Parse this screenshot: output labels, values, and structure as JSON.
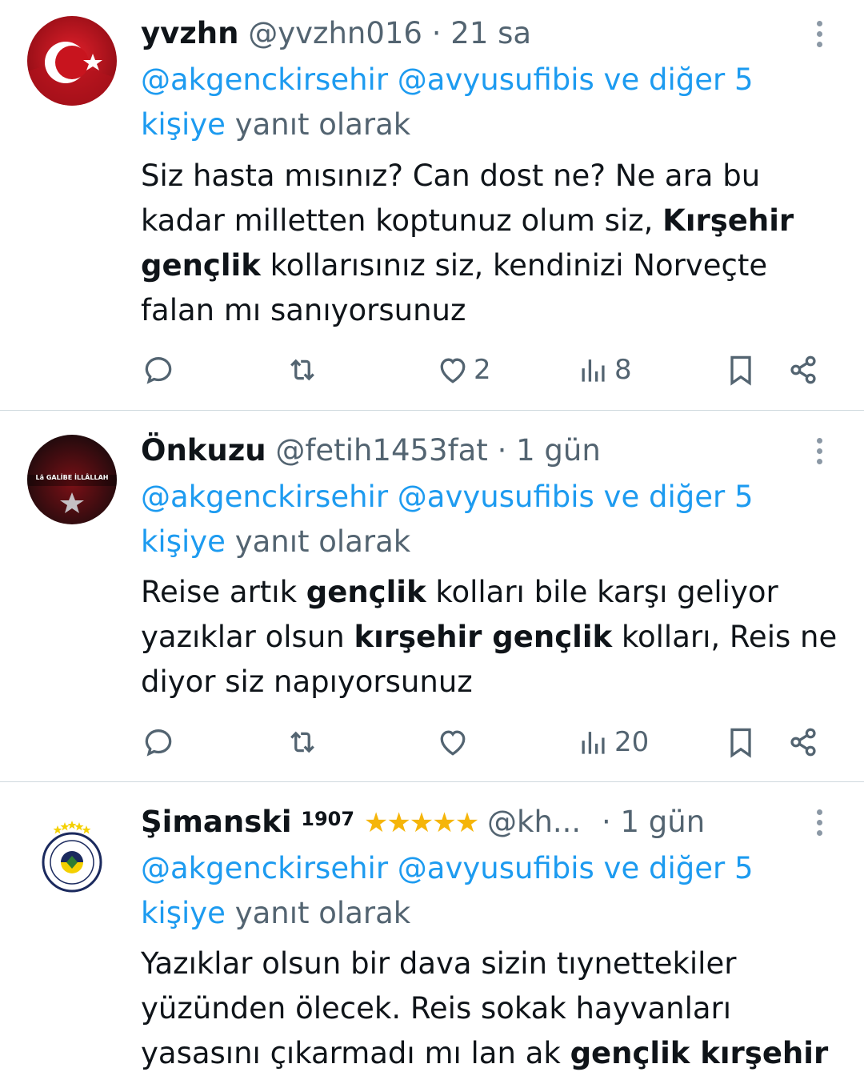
{
  "tweets": [
    {
      "display_name": "yvzhn",
      "handle": "@yvzhn016",
      "time": "21 sa",
      "reply_mentions": "@akgenckirsehir @avyusufibis ve diğer 5 kişiye",
      "reply_suffix": "yanıt olarak",
      "body_parts": [
        {
          "text": "Siz hasta mısınız? Can dost ne? Ne ara bu kadar milletten koptunuz olum siz, ",
          "bold": false
        },
        {
          "text": "Kırşehir gençlik",
          "bold": true
        },
        {
          "text": " kollarısınız siz, kendinizi Norveçte falan mı sanıyorsunuz",
          "bold": false
        }
      ],
      "likes": "2",
      "views": "8",
      "avatar": "turkish-flag"
    },
    {
      "display_name": "Önkuzu",
      "handle": "@fetih1453fat",
      "time": "1 gün",
      "reply_mentions": "@akgenckirsehir @avyusufibis ve diğer 5 kişiye",
      "reply_suffix": "yanıt olarak",
      "body_parts": [
        {
          "text": "Reise artık ",
          "bold": false
        },
        {
          "text": "gençlik",
          "bold": true
        },
        {
          "text": " kolları bile karşı geliyor yazıklar olsun ",
          "bold": false
        },
        {
          "text": "kırşehir gençlik",
          "bold": true
        },
        {
          "text": " kolları, Reis ne diyor siz napıyorsunuz",
          "bold": false
        }
      ],
      "likes": "",
      "views": "20",
      "avatar_text": "Lâ GALİBE İLLÂLLAH"
    },
    {
      "display_name": "Şimanski",
      "name_sup": "1907",
      "name_stars": "★★★★★",
      "handle": "@kh...",
      "time": "1 gün",
      "reply_mentions": "@akgenckirsehir @avyusufibis ve diğer 5 kişiye",
      "reply_suffix": "yanıt olarak",
      "body_parts": [
        {
          "text": "Yazıklar olsun bir dava sizin tıynettekiler yüzünden ölecek. Reis sokak hayvanları yasasını çıkarmadı mı lan ak ",
          "bold": false
        },
        {
          "text": "gençlik kırşehir",
          "bold": true
        }
      ],
      "avatar": "fenerbahce-crest"
    }
  ],
  "separator": "·",
  "colors": {
    "link": "#1d9bf0",
    "muted": "#536471",
    "text": "#0f1419",
    "divider": "#cfd9de"
  },
  "icons": [
    "reply-icon",
    "retweet-icon",
    "like-icon",
    "views-icon",
    "bookmark-icon",
    "share-icon",
    "more-icon"
  ]
}
